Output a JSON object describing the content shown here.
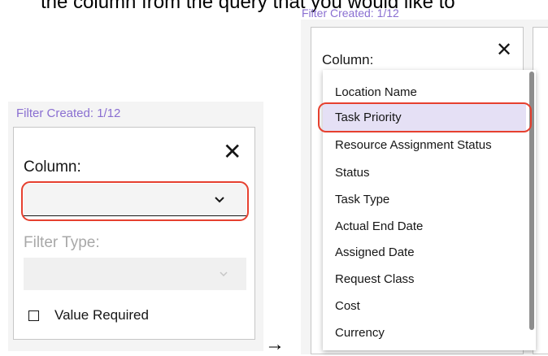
{
  "intro": {
    "text": "the column from the query that you would like to"
  },
  "left_panel": {
    "filter_created": "Filter Created: 1/12",
    "close_icon_glyph": "✕",
    "column_label": "Column:",
    "column_value": "",
    "chevron_glyph": "⌄",
    "filter_type_label": "Filter Type:",
    "filter_type_chevron_glyph": "⌄",
    "checkbox_label": "Value Required",
    "checkbox_checked": false
  },
  "arrow_glyph": "→",
  "right_panel": {
    "filter_created": "Filter Created: 1/12",
    "close_icon_glyph": "✕",
    "column_label": "Column:",
    "menu_items": [
      "Location Name",
      "Task Priority",
      "Resource Assignment Status",
      "Status",
      "Task Type",
      "Actual End Date",
      "Assigned Date",
      "Request Class",
      "Cost",
      "Currency"
    ],
    "selected_item": "Task Priority"
  },
  "colors": {
    "highlight": "#e6402f",
    "filter_created_text": "#8a6fd1",
    "selected_bg": "#e5e0f5"
  }
}
